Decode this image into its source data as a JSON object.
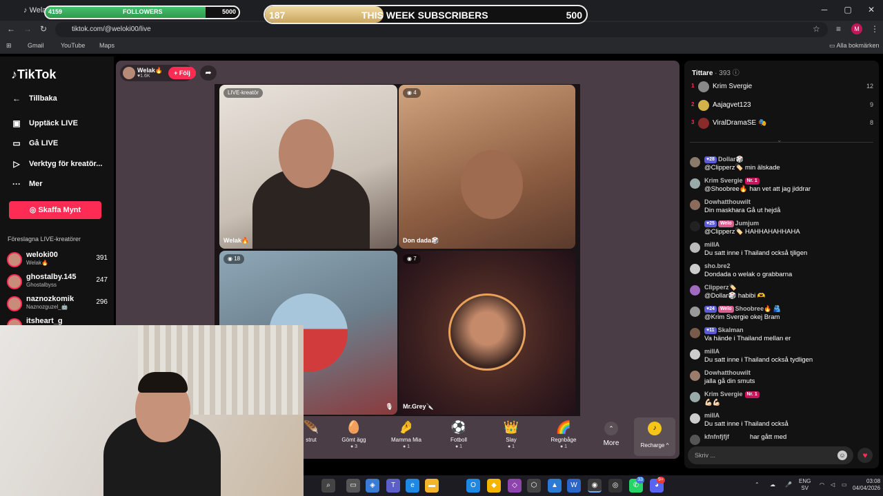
{
  "browser": {
    "tab_title": "Welak",
    "url": "tiktok.com/@weloki00/live",
    "bookmarks": [
      "Gmail",
      "YouTube",
      "Maps"
    ],
    "all_bookmarks": "Alla bokmärken",
    "profile_letter": "M"
  },
  "overlay": {
    "followers": {
      "current": "4159",
      "label": "FOLLOWERS",
      "goal": "5000",
      "progress": 0.83
    },
    "subscribers": {
      "current": "187",
      "label": "THIS WEEK SUBSCRIBERS",
      "goal": "500",
      "progress": 0.37
    }
  },
  "sidebar": {
    "logo": "TikTok",
    "back": "Tillbaka",
    "nav": [
      {
        "label": "Upptäck LIVE",
        "icon": "calendar-live-icon"
      },
      {
        "label": "Gå LIVE",
        "icon": "camera-icon"
      },
      {
        "label": "Verktyg för kreatör...",
        "icon": "tools-icon"
      },
      {
        "label": "Mer",
        "icon": "more-icon"
      }
    ],
    "buy_coins": "Skaffa Mynt",
    "suggested_header": "Föreslagna LIVE-kreatörer",
    "creators": [
      {
        "name": "weloki00",
        "sub": "Welak🔥",
        "count": "391"
      },
      {
        "name": "ghostalby.145",
        "sub": "Ghostalbyss",
        "count": "247"
      },
      {
        "name": "naznozkomik",
        "sub": "Naznozguzel_🤖",
        "count": "296"
      },
      {
        "name": "itsheart_g",
        "sub": "",
        "count": ""
      }
    ]
  },
  "live": {
    "host_name": "Welak🔥",
    "host_likes": "♥1.6K",
    "follow": "+ Följ",
    "cells": [
      {
        "badge": "LIVE-kreatör",
        "label": "Welak🔥"
      },
      {
        "badge": "4",
        "label": "Don dada🎲"
      },
      {
        "badge": "18",
        "label": ""
      },
      {
        "badge": "7",
        "label": "Mr.Grey🔪"
      }
    ]
  },
  "gifts": [
    {
      "name": "strut",
      "price": ""
    },
    {
      "name": "Gömt ägg",
      "price": "3"
    },
    {
      "name": "Mamma Mia",
      "price": "1"
    },
    {
      "name": "Fotboll",
      "price": "1"
    },
    {
      "name": "Slay",
      "price": "1"
    },
    {
      "name": "Regnbåge",
      "price": "1"
    }
  ],
  "more": "More",
  "recharge": "Recharge ^",
  "viewers": {
    "title": "Tittare",
    "count": "· 393",
    "top": [
      {
        "rank": "1",
        "name": "Krim Svergie",
        "value": "12"
      },
      {
        "rank": "2",
        "name": "Aajagvet123",
        "value": "9"
      },
      {
        "rank": "3",
        "name": "ViralDramaSE 🎭",
        "value": "8"
      }
    ]
  },
  "chat": [
    {
      "badge": "28",
      "user": "Dollar🎲",
      "msg": "@Clipperz🏷️ min älskade"
    },
    {
      "badge_nr": "Nr. 1",
      "user": "Krim Svergie",
      "msg": "@Shoobree🔥 han vet att jag jiddrar"
    },
    {
      "user": "Dowhatthouwilt",
      "msg": "Din maskhara Gå ut hejdå"
    },
    {
      "badge": "25",
      "badge_w": "Welo",
      "user": "Jumjum",
      "msg": "@Clipperz🏷️ HAHHAHAHHAHA"
    },
    {
      "user": "millA",
      "msg": "Du satt inne i Thailand också tjligen"
    },
    {
      "user": "sho.bre2",
      "msg": "Dondada o welak o grabbarna"
    },
    {
      "user": "Clipperz🏷️",
      "msg": "@Dollar🎲 habibi 🫶"
    },
    {
      "badge": "24",
      "badge_w": "Welo",
      "user": "Shoobree🔥 🫂",
      "msg": "@Krim Svergie okej Bram"
    },
    {
      "badge": "11",
      "user": "Skalman",
      "msg": "Va hände i Thailand mellan er"
    },
    {
      "user": "millA",
      "msg": "Du satt inne i Thailand också tydligen"
    },
    {
      "user": "Dowhatthouwilt",
      "msg": "jalla gå din smuts"
    },
    {
      "badge_nr": "Nr. 1",
      "user": "Krim Svergie",
      "msg": "💪🏻💪🏻"
    },
    {
      "user": "millA",
      "msg": "Du satt inne i Thailand också"
    },
    {
      "user": "kfnfnfjfjf",
      "msg": "har gått med",
      "inline": true
    }
  ],
  "chat_input_placeholder": "Skriv ...",
  "taskbar": {
    "lang": "ENG",
    "lang2": "SV",
    "time": "03:08",
    "date": "04/04/2026",
    "badge_whatsapp": "33",
    "badge_discord": "9+"
  }
}
